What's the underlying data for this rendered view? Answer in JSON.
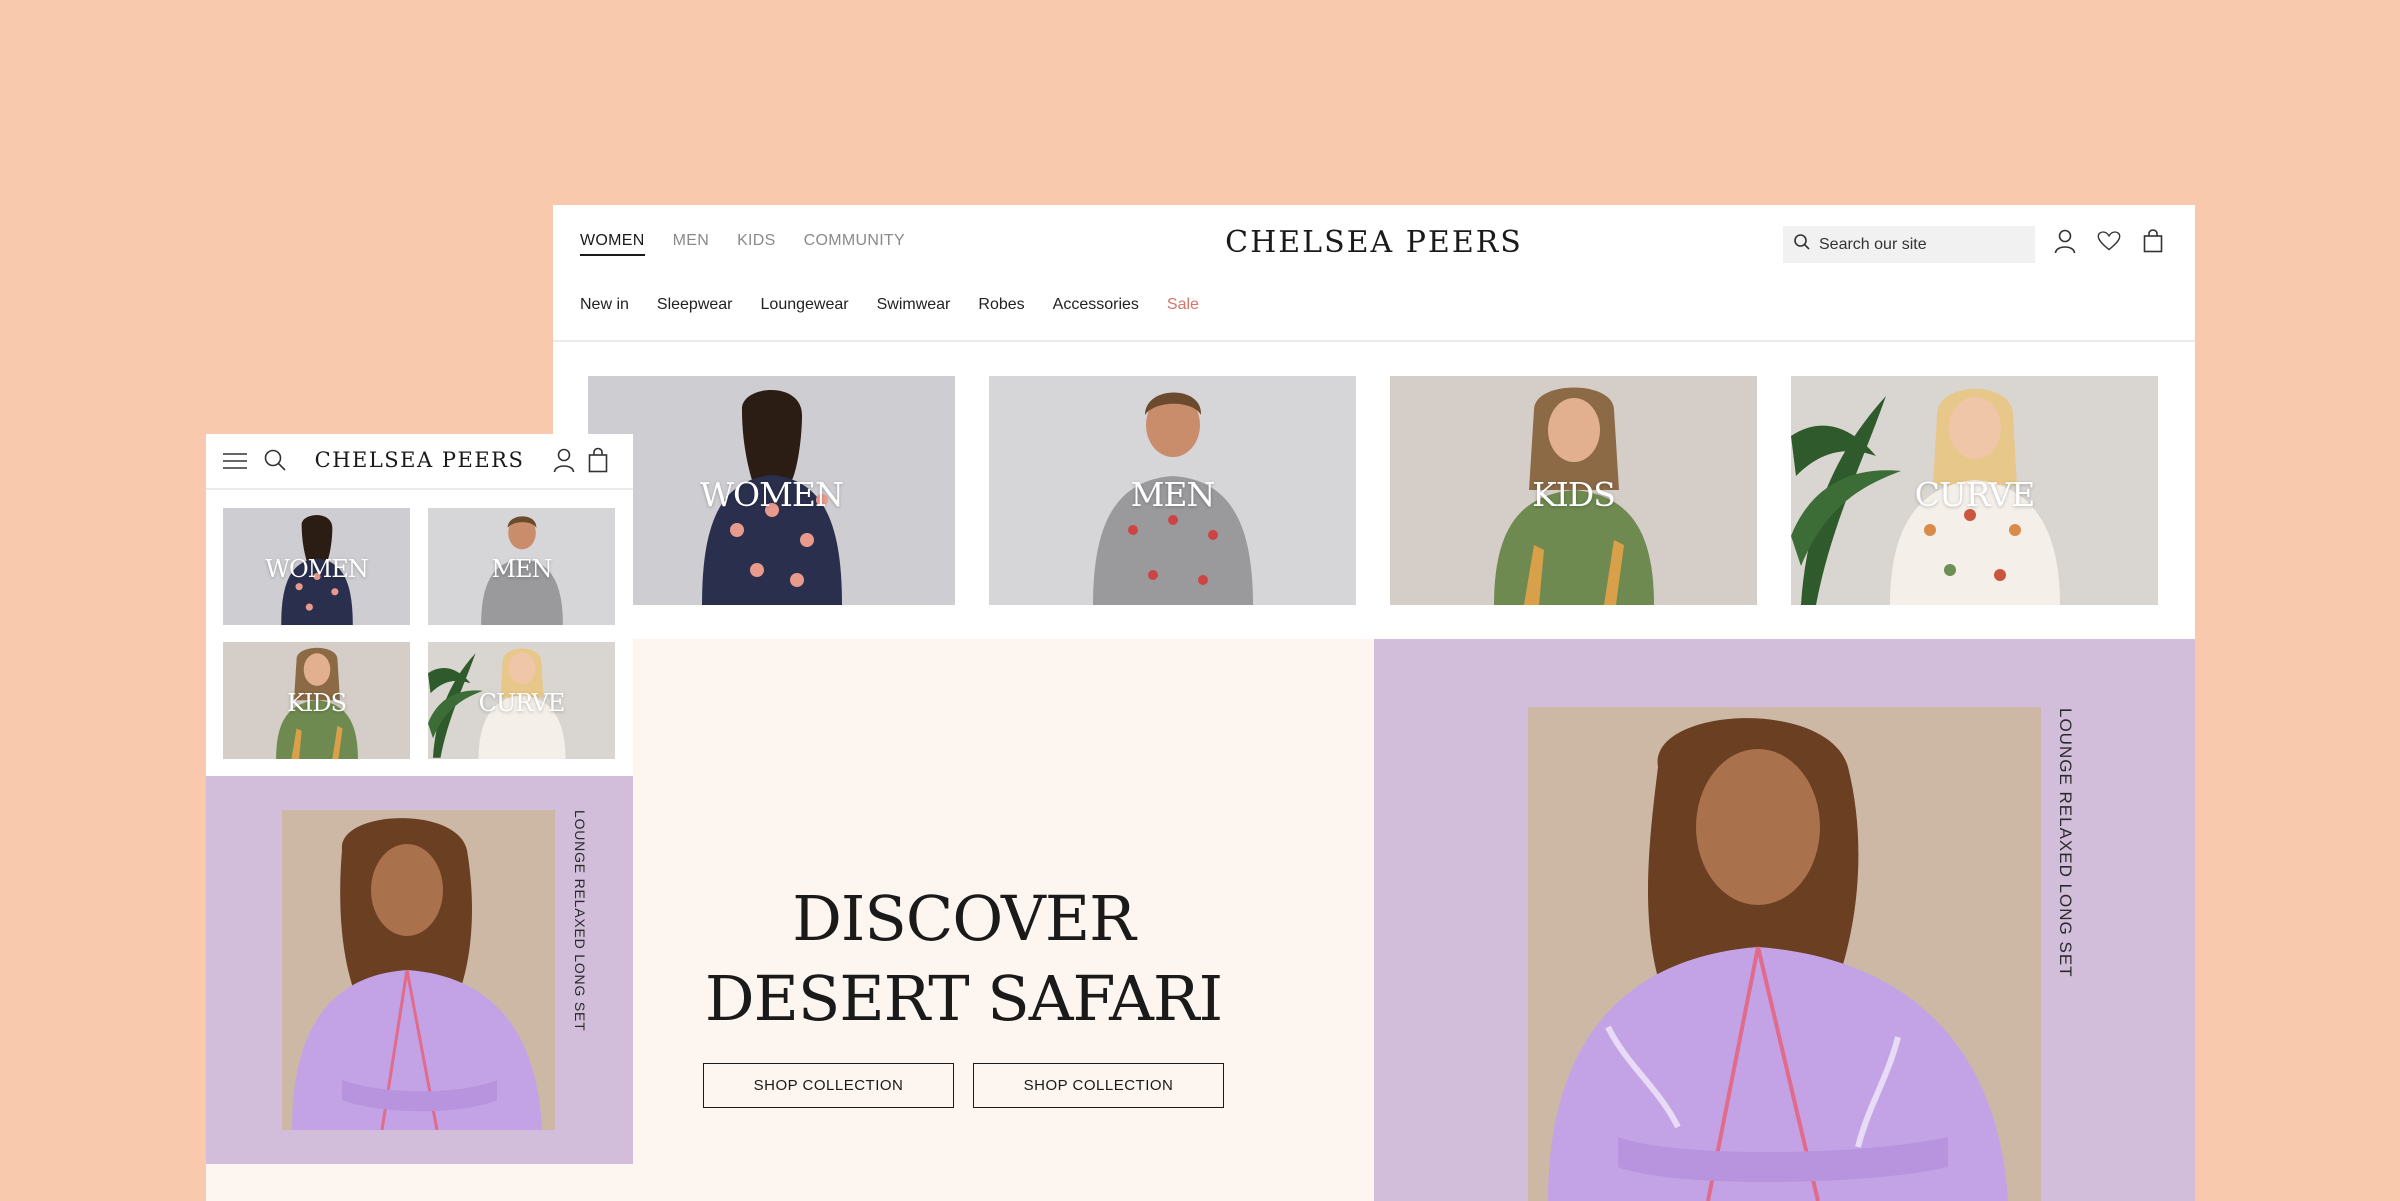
{
  "colors": {
    "background": "#f8c9ac",
    "hero_purple": "#d2bddb",
    "hero_cream": "#fdf5ef",
    "sale": "#d4756b"
  },
  "desktop": {
    "top_nav": [
      "WOMEN",
      "MEN",
      "KIDS",
      "COMMUNITY"
    ],
    "active_tab": "WOMEN",
    "logo": "CHELSEA PEERS",
    "search_placeholder": "Search our site",
    "header_icons": [
      "user-icon",
      "heart-icon",
      "bag-icon"
    ],
    "sub_nav": [
      "New in",
      "Sleepwear",
      "Loungewear",
      "Swimwear",
      "Robes",
      "Accessories",
      "Sale"
    ],
    "categories": [
      "WOMEN",
      "MEN",
      "KIDS",
      "CURVE"
    ],
    "hero": {
      "title_line1": "DISCOVER",
      "title_line2": "DESERT SAFARI",
      "button1": "SHOP COLLECTION",
      "button2": "SHOP COLLECTION",
      "vertical_label": "LOUNGE RELAXED LONG SET"
    }
  },
  "mobile": {
    "logo": "CHELSEA PEERS",
    "header_icons": [
      "menu-icon",
      "search-icon",
      "user-icon",
      "bag-icon"
    ],
    "categories": [
      "WOMEN",
      "MEN",
      "KIDS",
      "CURVE"
    ],
    "vertical_label": "LOUNGE RELAXED LONG SET"
  }
}
